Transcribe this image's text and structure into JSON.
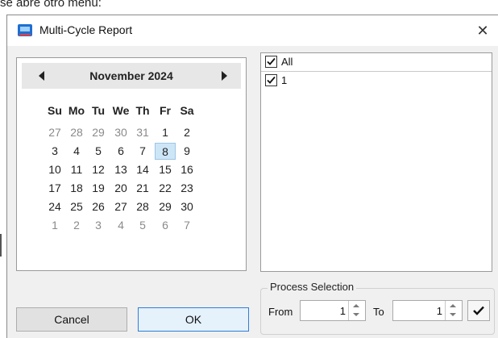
{
  "caption": "se abre otro menú:",
  "window": {
    "title": "Multi-Cycle Report",
    "app_icon": "report-app-icon",
    "close_glyph": "✕"
  },
  "calendar": {
    "month_label": "November 2024",
    "days_of_week": [
      "Su",
      "Mo",
      "Tu",
      "We",
      "Th",
      "Fr",
      "Sa"
    ],
    "weeks": [
      [
        {
          "d": "27",
          "o": true
        },
        {
          "d": "28",
          "o": true
        },
        {
          "d": "29",
          "o": true
        },
        {
          "d": "30",
          "o": true
        },
        {
          "d": "31",
          "o": true
        },
        {
          "d": "1"
        },
        {
          "d": "2"
        }
      ],
      [
        {
          "d": "3"
        },
        {
          "d": "4"
        },
        {
          "d": "5"
        },
        {
          "d": "6"
        },
        {
          "d": "7"
        },
        {
          "d": "8",
          "sel": true
        },
        {
          "d": "9"
        }
      ],
      [
        {
          "d": "10"
        },
        {
          "d": "11"
        },
        {
          "d": "12"
        },
        {
          "d": "13"
        },
        {
          "d": "14"
        },
        {
          "d": "15"
        },
        {
          "d": "16"
        }
      ],
      [
        {
          "d": "17"
        },
        {
          "d": "18"
        },
        {
          "d": "19"
        },
        {
          "d": "20"
        },
        {
          "d": "21"
        },
        {
          "d": "22"
        },
        {
          "d": "23"
        }
      ],
      [
        {
          "d": "24"
        },
        {
          "d": "25"
        },
        {
          "d": "26"
        },
        {
          "d": "27"
        },
        {
          "d": "28"
        },
        {
          "d": "29"
        },
        {
          "d": "30"
        }
      ],
      [
        {
          "d": "1",
          "o": true
        },
        {
          "d": "2",
          "o": true
        },
        {
          "d": "3",
          "o": true
        },
        {
          "d": "4",
          "o": true
        },
        {
          "d": "5",
          "o": true
        },
        {
          "d": "6",
          "o": true
        },
        {
          "d": "7",
          "o": true
        }
      ]
    ],
    "selected_color": "#cde6f7"
  },
  "cycle_list": {
    "header_label": "All",
    "header_checked": true,
    "items": [
      {
        "label": "1",
        "checked": true
      }
    ]
  },
  "buttons": {
    "cancel_label": "Cancel",
    "ok_label": "OK",
    "ok_border_color": "#2f7fd6"
  },
  "process_selection": {
    "legend": "Process Selection",
    "from_label": "From",
    "from_value": "1",
    "to_label": "To",
    "to_value": "1",
    "apply_icon": "checkmark-icon"
  }
}
